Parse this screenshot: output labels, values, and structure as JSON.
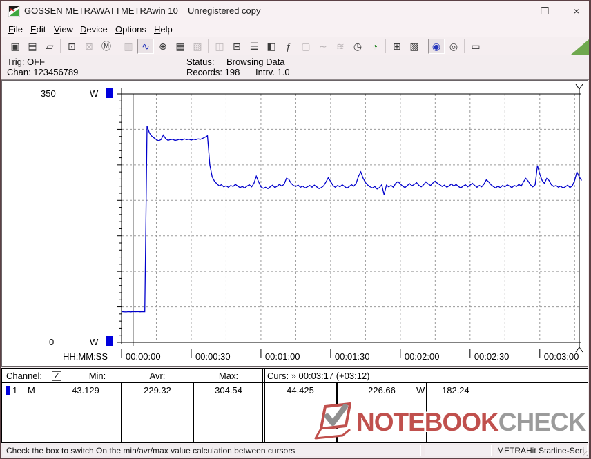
{
  "window": {
    "title_left": "GOSSEN METRAWATT",
    "title_mid": "METRAwin 10",
    "title_right": "Unregistered copy",
    "controls": {
      "minimize": "–",
      "maximize": "❐",
      "close": "×"
    }
  },
  "menu": {
    "items": [
      {
        "label": "File"
      },
      {
        "label": "Edit"
      },
      {
        "label": "View"
      },
      {
        "label": "Device"
      },
      {
        "label": "Options"
      },
      {
        "label": "Help"
      }
    ]
  },
  "toolbar": {
    "corner_triangle_color": "#6fa84e",
    "buttons": [
      {
        "name": "save-button",
        "glyph": "▣",
        "state": "normal"
      },
      {
        "name": "save-as-button",
        "glyph": "▤",
        "state": "normal"
      },
      {
        "name": "open-button",
        "glyph": "▱",
        "state": "normal"
      },
      {
        "sep": true
      },
      {
        "name": "read-device-button",
        "glyph": "⊡",
        "state": "normal"
      },
      {
        "name": "clear-device-button",
        "glyph": "⊠",
        "state": "disabled"
      },
      {
        "name": "memory-read-button",
        "glyph": "Ⓜ",
        "state": "normal"
      },
      {
        "sep": true
      },
      {
        "name": "numeric-display-button",
        "glyph": "▥",
        "state": "disabled"
      },
      {
        "name": "chart-view-button",
        "glyph": "∿",
        "state": "pressed",
        "color": "#2233bb"
      },
      {
        "name": "cursor-button",
        "glyph": "⊕",
        "state": "normal"
      },
      {
        "name": "table-view-button",
        "glyph": "▦",
        "state": "normal"
      },
      {
        "name": "histogram-button",
        "glyph": "▨",
        "state": "disabled"
      },
      {
        "sep": true
      },
      {
        "name": "copy-button",
        "glyph": "◫",
        "state": "disabled"
      },
      {
        "name": "store-button",
        "glyph": "⊟",
        "state": "normal"
      },
      {
        "name": "channel-list-button",
        "glyph": "☰",
        "state": "normal"
      },
      {
        "name": "monitor-button",
        "glyph": "◧",
        "state": "normal"
      },
      {
        "name": "formula-button",
        "glyph": "ƒ",
        "state": "normal"
      },
      {
        "name": "device-panel-button",
        "glyph": "▢",
        "state": "disabled"
      },
      {
        "name": "wave-button",
        "glyph": "∼",
        "state": "disabled"
      },
      {
        "name": "wave-dense-button",
        "glyph": "≋",
        "state": "disabled"
      },
      {
        "name": "time-sync-button",
        "glyph": "◷",
        "state": "normal"
      },
      {
        "name": "timer-button",
        "glyph": "◔",
        "state": "normal",
        "color": "#2e8b2e"
      },
      {
        "sep": true
      },
      {
        "name": "print-preview-button",
        "glyph": "⊞",
        "state": "normal"
      },
      {
        "name": "print-button",
        "glyph": "▧",
        "state": "normal"
      },
      {
        "sep": true
      },
      {
        "name": "zoom-wave-button",
        "glyph": "◉",
        "state": "pressed",
        "color": "#2233bb"
      },
      {
        "name": "zoom-lens-button",
        "glyph": "◎",
        "state": "normal"
      },
      {
        "sep": true
      },
      {
        "name": "tooltip-button",
        "glyph": "▭",
        "state": "normal"
      }
    ]
  },
  "status_panel": {
    "trig": "Trig: OFF",
    "chan": "Chan: 123456789",
    "status_label": "Status:",
    "status_value": "Browsing Data",
    "records": "Records: 198",
    "interval": "Intrv. 1.0"
  },
  "chart_data": {
    "type": "line",
    "title": "Power vs time log",
    "ylabel": "W",
    "y_top_label": "350",
    "y_bottom_label": "0",
    "ylim": [
      0,
      350
    ],
    "grid": true,
    "xlabel": "HH:MM:SS",
    "x_ticks": [
      "00:00:00",
      "00:00:30",
      "00:01:00",
      "00:01:30",
      "00:02:00",
      "00:02:30",
      "00:03:00"
    ],
    "x_tick_interval_sec": 30,
    "v_grid_interval_sec": 15,
    "h_grid_interval_w": 50,
    "cursors": {
      "c1_sec": 5,
      "c2_sec": 197,
      "c2_time": "00:03:17"
    },
    "series": [
      {
        "name": "channel-1-power",
        "color": "#0000cc",
        "interval_sec": 1,
        "values": [
          43.4,
          43.1,
          42.9,
          43.3,
          43.0,
          43.5,
          43.2,
          43.4,
          43.1,
          43.3,
          43.2,
          304.5,
          295.0,
          290.5,
          288.0,
          285.5,
          284.0,
          285.5,
          292.0,
          287.0,
          284.5,
          285.5,
          286.0,
          284.5,
          285.0,
          286.0,
          285.0,
          286.5,
          285.5,
          286.0,
          285.0,
          286.0,
          285.5,
          286.5,
          286.0,
          287.5,
          289.0,
          291.0,
          250.0,
          233.0,
          227.0,
          223.5,
          220.5,
          222.0,
          219.0,
          220.5,
          218.5,
          221.0,
          219.5,
          222.5,
          220.0,
          218.0,
          219.5,
          217.5,
          220.0,
          222.0,
          219.0,
          224.0,
          234.0,
          226.0,
          219.0,
          217.0,
          218.5,
          216.5,
          219.0,
          221.5,
          218.0,
          220.0,
          222.5,
          220.0,
          223.0,
          231.0,
          229.5,
          224.0,
          221.0,
          219.5,
          221.5,
          218.5,
          220.0,
          217.5,
          219.0,
          221.0,
          218.5,
          221.5,
          219.0,
          216.5,
          218.0,
          220.5,
          226.0,
          232.0,
          226.5,
          221.0,
          218.5,
          221.0,
          219.0,
          222.0,
          219.5,
          217.0,
          219.5,
          222.0,
          220.0,
          224.0,
          234.0,
          240.0,
          231.0,
          225.0,
          221.5,
          219.0,
          217.5,
          219.5,
          216.0,
          218.0,
          222.0,
          208.0,
          221.5,
          219.0,
          221.0,
          218.5,
          224.0,
          226.5,
          223.0,
          220.0,
          218.0,
          221.0,
          223.5,
          220.5,
          222.5,
          225.0,
          221.0,
          219.0,
          222.0,
          226.0,
          223.0,
          221.0,
          224.5,
          227.0,
          224.0,
          222.0,
          219.5,
          221.5,
          218.5,
          220.5,
          223.0,
          220.0,
          222.5,
          219.5,
          217.5,
          220.0,
          222.0,
          219.0,
          221.5,
          224.0,
          221.0,
          218.5,
          221.0,
          219.0,
          223.0,
          229.0,
          226.0,
          222.0,
          219.5,
          217.5,
          220.0,
          218.0,
          221.0,
          219.0,
          222.0,
          220.0,
          218.0,
          221.0,
          219.5,
          222.5,
          220.0,
          226.0,
          231.0,
          227.0,
          222.0,
          219.0,
          222.0,
          249.0,
          237.0,
          228.0,
          224.0,
          231.0,
          228.0,
          222.0,
          219.5,
          221.0,
          218.5,
          220.0,
          217.5,
          219.0,
          221.5,
          218.0,
          220.5,
          228.0,
          240.0,
          233.0,
          228.0
        ]
      }
    ]
  },
  "channel_table": {
    "headers": {
      "channel": "Channel:",
      "min": "Min:",
      "avr": "Avr:",
      "max": "Max:",
      "curs": "Curs: » 00:03:17 (+03:12)"
    },
    "checkbox_checked": "✓",
    "row": {
      "num": "1",
      "mode": "M",
      "min": "43.129",
      "avr": "229.32",
      "max": "304.54",
      "curs1": "44.425",
      "curs2": "226.66",
      "curs2_unit": "W",
      "curs_diff": "182.24"
    }
  },
  "watermark": {
    "notebook": "NOTEBOOK",
    "check": "CHECK"
  },
  "status_bar": {
    "message": "Check the box to switch On the min/avr/max value calculation between cursors",
    "middle": "",
    "device": "METRAHit Starline-Seri"
  }
}
